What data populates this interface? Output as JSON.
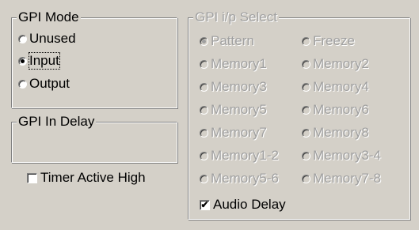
{
  "gpi_mode": {
    "title": "GPI Mode",
    "options": [
      "Unused",
      "Input",
      "Output"
    ],
    "selected": "Input"
  },
  "gpi_in_delay": {
    "title": "GPI In Delay"
  },
  "timer_active_high": {
    "label": "Timer Active High",
    "checked": false
  },
  "gpi_ip_select": {
    "title": "GPI i/p Select",
    "options": [
      "Pattern",
      "Freeze",
      "Memory1",
      "Memory2",
      "Memory3",
      "Memory4",
      "Memory5",
      "Memory6",
      "Memory7",
      "Memory8",
      "Memory1-2",
      "Memory3-4",
      "Memory5-6",
      "Memory7-8"
    ],
    "selected": "Pattern",
    "enabled": false
  },
  "audio_delay": {
    "label": "Audio Delay",
    "checked": true,
    "check_glyph": "✔"
  }
}
